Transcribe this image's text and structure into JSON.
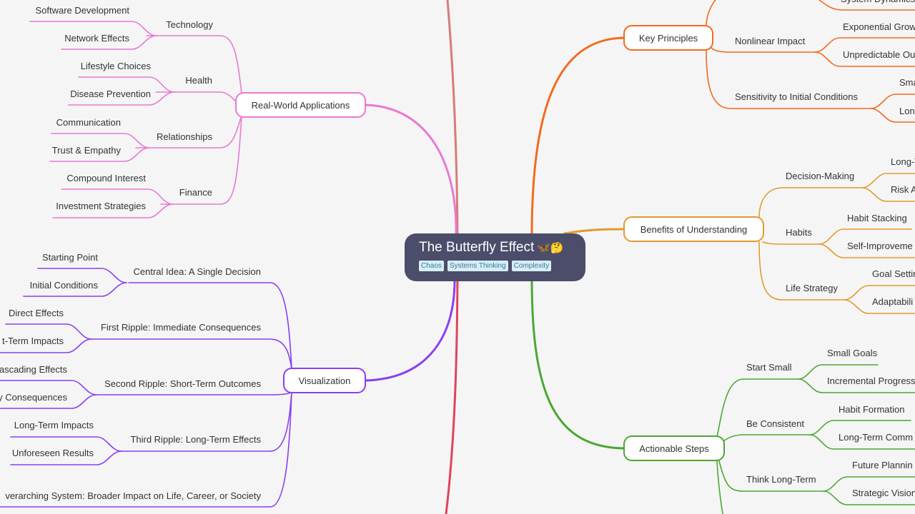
{
  "root": {
    "title": "The Butterfly Effect",
    "emoji": "🦋🤔",
    "tags": [
      "Chaos",
      "Systems Thinking",
      "Complexity"
    ]
  },
  "colors": {
    "background": "#f5f5f5",
    "root_fill": "#4b4d6a",
    "tag_fill": "#d6eef8",
    "tag_text": "#3c7a9a",
    "real_world": "#e879d4",
    "visualization": "#8a3ff0",
    "key_principles": "#f26b1d",
    "benefits": "#e39a2e",
    "actionable": "#4aa832",
    "offscreen_top": "#d87a7a",
    "offscreen_bottom": "#e0435a"
  },
  "branches": {
    "real_world": {
      "label": "Real-World Applications",
      "children": [
        {
          "label": "Technology",
          "leaves": [
            "Software Development",
            "Network Effects"
          ]
        },
        {
          "label": "Health",
          "leaves": [
            "Lifestyle Choices",
            "Disease Prevention"
          ]
        },
        {
          "label": "Relationships",
          "leaves": [
            "Communication",
            "Trust & Empathy"
          ]
        },
        {
          "label": "Finance",
          "leaves": [
            "Compound Interest",
            "Investment Strategies"
          ]
        }
      ]
    },
    "visualization": {
      "label": "Visualization",
      "children": [
        {
          "label": "Central Idea: A Single Decision",
          "leaves": [
            "Starting Point",
            "Initial Conditions"
          ]
        },
        {
          "label": "First Ripple: Immediate Consequences",
          "leaves": [
            "Direct Effects",
            "t-Term Impacts"
          ]
        },
        {
          "label": "Second Ripple: Short-Term Outcomes",
          "leaves": [
            "ascading Effects",
            "y Consequences"
          ]
        },
        {
          "label": "Third Ripple: Long-Term Effects",
          "leaves": [
            "Long-Term Impacts",
            "Unforeseen Results"
          ]
        },
        {
          "label": "verarching System: Broader Impact on Life, Career, or Society",
          "leaves": []
        }
      ]
    },
    "key_principles": {
      "label": "Key Principles",
      "children": [
        {
          "label": "",
          "leaves": [
            "System Dynamics"
          ]
        },
        {
          "label": "Nonlinear Impact",
          "leaves": [
            "Exponential Grow",
            "Unpredictable Ou"
          ]
        },
        {
          "label": "Sensitivity to Initial Conditions",
          "leaves": [
            "Sma",
            "Lon"
          ]
        }
      ]
    },
    "benefits": {
      "label": "Benefits of Understanding",
      "children": [
        {
          "label": "Decision-Making",
          "leaves": [
            "Long-T",
            "Risk A"
          ]
        },
        {
          "label": "Habits",
          "leaves": [
            "Habit Stacking",
            "Self-Improveme"
          ]
        },
        {
          "label": "Life Strategy",
          "leaves": [
            "Goal Settin",
            "Adaptabili"
          ]
        }
      ]
    },
    "actionable": {
      "label": "Actionable Steps",
      "children": [
        {
          "label": "Start Small",
          "leaves": [
            "Small Goals",
            "Incremental Progress"
          ]
        },
        {
          "label": "Be Consistent",
          "leaves": [
            "Habit Formation",
            "Long-Term Comm"
          ]
        },
        {
          "label": "Think Long-Term",
          "leaves": [
            "Future Plannin",
            "Strategic Vision"
          ]
        }
      ]
    }
  }
}
